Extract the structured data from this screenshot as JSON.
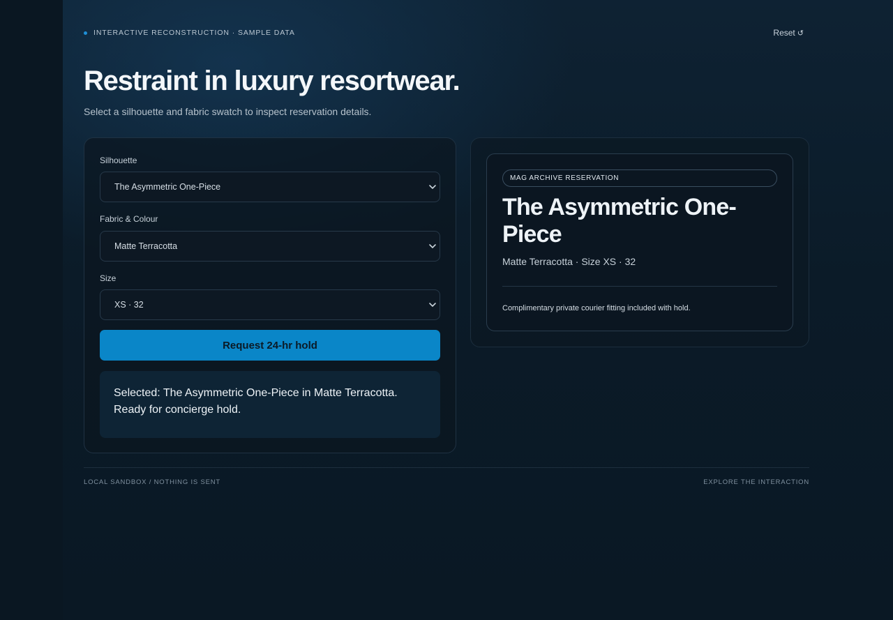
{
  "header": {
    "eyebrow": "INTERACTIVE RECONSTRUCTION · SAMPLE DATA",
    "reset_label": "Reset",
    "reset_icon": "refresh-icon",
    "title": "Restraint in luxury resortwear.",
    "subtitle": "Select a silhouette and fabric swatch to inspect reservation details."
  },
  "form": {
    "silhouette": {
      "label": "Silhouette",
      "value": "The Asymmetric One-Piece"
    },
    "fabric": {
      "label": "Fabric & Colour",
      "value": "Matte Terracotta"
    },
    "size": {
      "label": "Size",
      "value": "XS · 32"
    },
    "cta_label": "Request 24-hr hold",
    "status": "Selected: The Asymmetric One-Piece in Matte Terracotta. Ready for concierge hold."
  },
  "detail": {
    "badge": "MAG ARCHIVE RESERVATION",
    "product": "The Asymmetric One-Piece",
    "meta": "Matte Terracotta · Size XS · 32",
    "note": "Complimentary private courier fitting included with hold."
  },
  "footer": {
    "left": "LOCAL SANDBOX / NOTHING IS SENT",
    "right": "EXPLORE THE INTERACTION"
  },
  "colors": {
    "accent": "#0a86c8",
    "background": "#0b1a26",
    "dot": "#1f8fd6"
  }
}
